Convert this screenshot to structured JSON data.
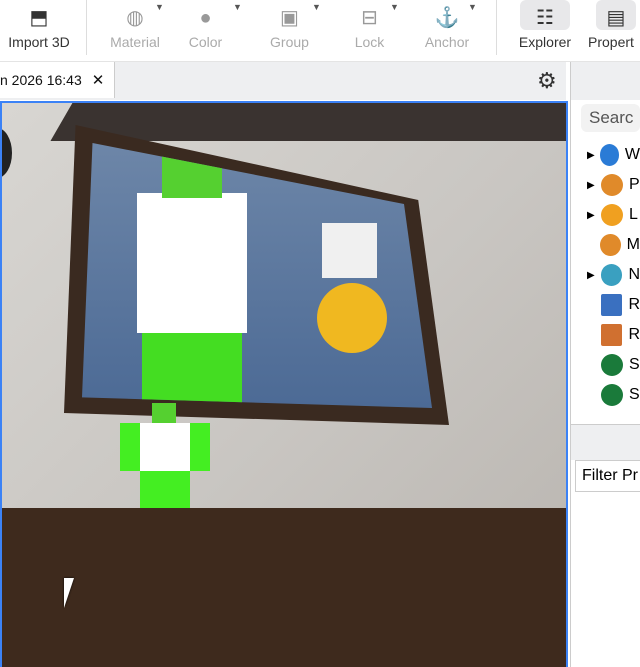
{
  "toolbar": {
    "items": [
      {
        "label": "Import 3D",
        "icon": "import-3d-icon",
        "enabled": true
      },
      {
        "label": "Material",
        "icon": "material-icon",
        "enabled": false
      },
      {
        "label": "Color",
        "icon": "color-icon",
        "enabled": false
      },
      {
        "label": "Group",
        "icon": "group-icon",
        "enabled": false
      },
      {
        "label": "Lock",
        "icon": "lock-icon",
        "enabled": false
      },
      {
        "label": "Anchor",
        "icon": "anchor-icon",
        "enabled": false
      },
      {
        "label": "Explorer",
        "icon": "explorer-icon",
        "enabled": true
      },
      {
        "label": "Propert",
        "icon": "properties-icon",
        "enabled": true
      }
    ]
  },
  "tab": {
    "title": "n 2026 16:43",
    "close": "✕"
  },
  "explorer": {
    "search_placeholder": "Searc",
    "items": [
      {
        "label": "W",
        "icon": "workspace-icon",
        "color": "#2a7bd6"
      },
      {
        "label": "P",
        "icon": "players-icon",
        "color": "#e08a2a"
      },
      {
        "label": "L",
        "icon": "lighting-icon",
        "color": "#f0a020"
      },
      {
        "label": "M",
        "icon": "material-service-icon",
        "color": "#e08a2a"
      },
      {
        "label": "N",
        "icon": "network-icon",
        "color": "#3aa0c0"
      },
      {
        "label": "R",
        "icon": "replicated-icon",
        "color": "#3a70c0"
      },
      {
        "label": "R",
        "icon": "storage-icon",
        "color": "#d07030"
      },
      {
        "label": "S",
        "icon": "server-script-icon",
        "color": "#1a7a3a"
      },
      {
        "label": "S",
        "icon": "server-storage-icon",
        "color": "#1a7a3a"
      }
    ]
  },
  "properties": {
    "filter_placeholder": "Filter Pr"
  },
  "colors": {
    "accent": "#3b82f6"
  }
}
